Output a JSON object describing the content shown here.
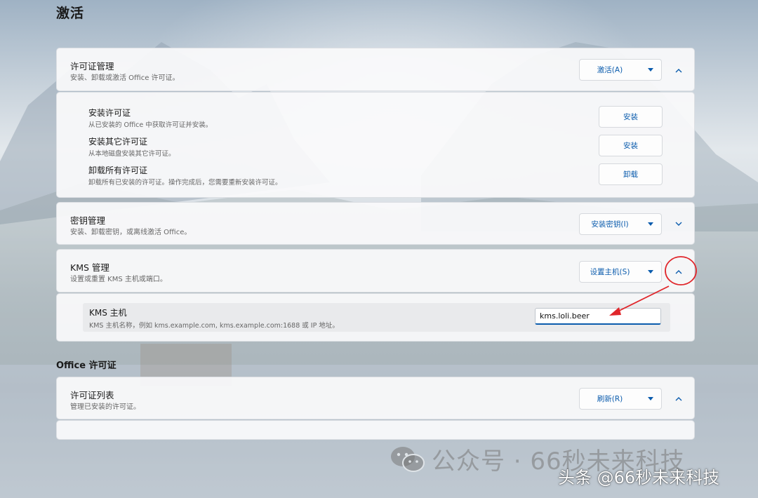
{
  "page": {
    "title": "激活"
  },
  "license_card": {
    "title": "许可证管理",
    "desc": "安装、卸载或激活 Office 许可证。",
    "action_label": "激活(A)"
  },
  "license_rows": [
    {
      "title": "安装许可证",
      "desc": "从已安装的 Office 中获取许可证并安装。",
      "button": "安装"
    },
    {
      "title": "安装其它许可证",
      "desc": "从本地磁盘安装其它许可证。",
      "button": "安装"
    },
    {
      "title": "卸载所有许可证",
      "desc": "卸载所有已安装的许可证。操作完成后，您需要重新安装许可证。",
      "button": "卸载"
    }
  ],
  "key_card": {
    "title": "密钥管理",
    "desc": "安装、卸载密钥，或离线激活 Office。",
    "action_label": "安装密钥(I)"
  },
  "kms_card": {
    "title": "KMS 管理",
    "desc": "设置或重置 KMS 主机或端口。",
    "action_label": "设置主机(S)"
  },
  "kms_host": {
    "title": "KMS 主机",
    "desc": "KMS 主机名称，例如 kms.example.com, kms.example.com:1688 或 IP 地址。",
    "value": "kms.loli.beer"
  },
  "office_section": {
    "label": "Office 许可证"
  },
  "list_card": {
    "title": "许可证列表",
    "desc": "管理已安装的许可证。",
    "action_label": "刷新(R)"
  },
  "icons": {
    "expand_up": "chevron-up-icon",
    "expand_down": "chevron-down-icon",
    "dropdown": "caret-down-icon"
  },
  "watermark": {
    "line1": "公众号 · 66秒未来科技",
    "line2": "头条 @66秒未来科技"
  },
  "colors": {
    "accent": "#0b5cad",
    "annotation": "#e0262b"
  }
}
